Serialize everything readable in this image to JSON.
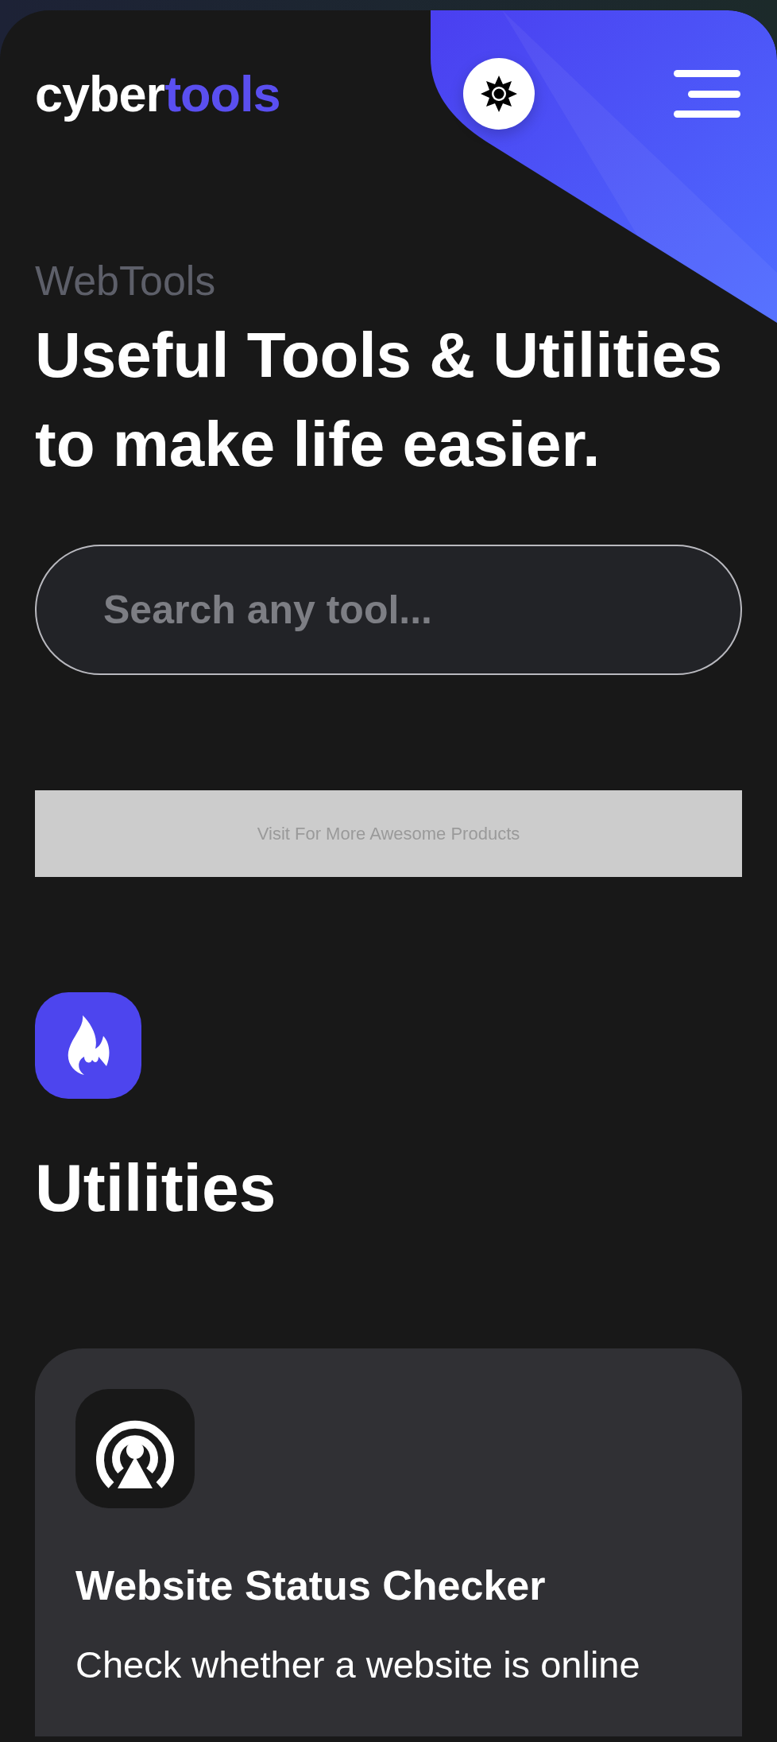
{
  "header": {
    "logo": {
      "primary": "cyber",
      "accent": "tools"
    }
  },
  "hero": {
    "eyebrow": "WebTools",
    "title": "Useful Tools & Utilities to make life easier."
  },
  "search": {
    "placeholder": "Search any tool..."
  },
  "ad_banner": {
    "text": "Visit For More Awesome Products"
  },
  "section": {
    "title": "Utilities"
  },
  "tools": [
    {
      "title": "Website Status Checker",
      "description": "Check whether a website is online"
    }
  ]
}
